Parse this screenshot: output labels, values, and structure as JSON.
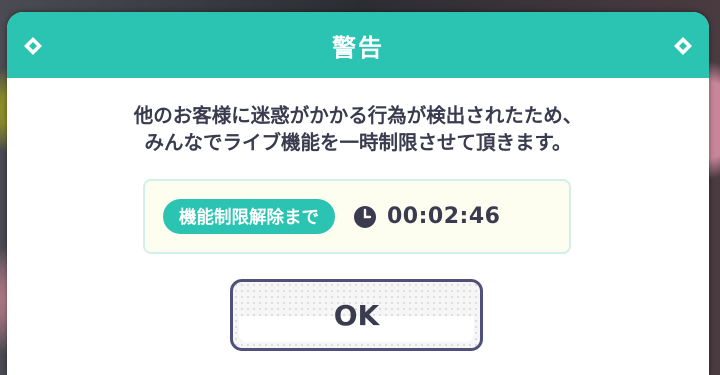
{
  "dialog": {
    "title": "警告",
    "message_line1": "他のお客様に迷惑がかかる行為が検出されたため、",
    "message_line2": "みんなでライブ機能を一時制限させて頂きます。",
    "timer_label": "機能制限解除まで",
    "timer_value": "00:02:46",
    "ok_label": "OK"
  },
  "icons": {
    "header_left": "diamond-icon",
    "header_right": "diamond-icon",
    "timer": "clock-icon"
  },
  "colors": {
    "accent": "#2bc3b1",
    "text": "#3b3b50",
    "button_border": "#50507a",
    "timer_bg": "#fdfdf0"
  }
}
